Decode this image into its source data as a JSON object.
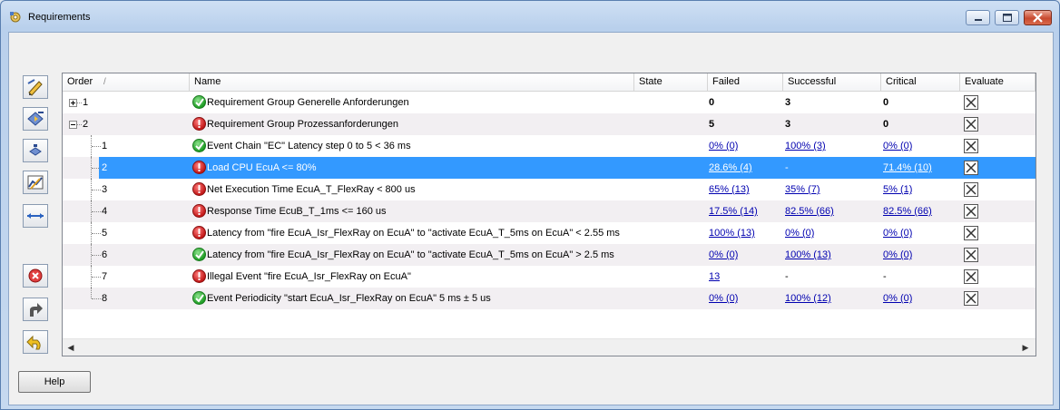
{
  "window": {
    "title": "Requirements"
  },
  "toolbar": {
    "buttons": [
      {
        "name": "edit-requirement-button",
        "icon": "pencil-icon"
      },
      {
        "name": "add-group-button",
        "icon": "add-group-icon"
      },
      {
        "name": "add-item-button",
        "icon": "add-item-icon"
      },
      {
        "name": "chart-button",
        "icon": "chart-icon"
      },
      {
        "name": "link-button",
        "icon": "arrows-icon"
      },
      {
        "name": "delete-button",
        "icon": "delete-icon"
      },
      {
        "name": "redo-button",
        "icon": "redo-icon"
      },
      {
        "name": "undo-button",
        "icon": "undo-icon"
      }
    ]
  },
  "grid": {
    "columns": {
      "order": "Order",
      "name": "Name",
      "state": "State",
      "failed": "Failed",
      "successful": "Successful",
      "critical": "Critical",
      "evaluate": "Evaluate"
    },
    "sort_indicator": "/",
    "rows": [
      {
        "order": "1",
        "name": "Requirement Group Generelle Anforderungen",
        "status": "ok",
        "failed": "0",
        "successful": "3",
        "critical": "0",
        "level": 0,
        "expander": "plus"
      },
      {
        "order": "2",
        "name": "Requirement Group Prozessanforderungen",
        "status": "error",
        "failed": "5",
        "successful": "3",
        "critical": "0",
        "level": 0,
        "expander": "minus"
      },
      {
        "order": "1",
        "name": "Event Chain \"EC\" Latency step 0 to 5 < 36 ms",
        "status": "ok",
        "failed": "0% (0)",
        "successful": "100% (3)",
        "critical": "0% (0)",
        "level": 1
      },
      {
        "order": "2",
        "name": "Load CPU EcuA <= 80%",
        "status": "error",
        "failed": "28.6% (4)",
        "successful": "-",
        "critical": "71.4% (10)",
        "level": 1,
        "selected": true
      },
      {
        "order": "3",
        "name": "Net Execution Time EcuA_T_FlexRay < 800 us",
        "status": "error",
        "failed": "65% (13)",
        "successful": "35% (7)",
        "critical": "5% (1)",
        "level": 1
      },
      {
        "order": "4",
        "name": "Response Time EcuB_T_1ms <= 160 us",
        "status": "error",
        "failed": "17.5% (14)",
        "successful": "82.5% (66)",
        "critical": "82.5% (66)",
        "level": 1
      },
      {
        "order": "5",
        "name": "Latency from \"fire EcuA_Isr_FlexRay on EcuA\" to \"activate EcuA_T_5ms on EcuA\" < 2.55 ms",
        "status": "error",
        "failed": "100% (13)",
        "successful": "0% (0)",
        "critical": "0% (0)",
        "level": 1
      },
      {
        "order": "6",
        "name": "Latency from \"fire EcuA_Isr_FlexRay on EcuA\" to \"activate EcuA_T_5ms on EcuA\" > 2.5 ms",
        "status": "ok",
        "failed": "0% (0)",
        "successful": "100% (13)",
        "critical": "0% (0)",
        "level": 1
      },
      {
        "order": "7",
        "name": "Illegal Event \"fire EcuA_Isr_FlexRay on EcuA\"",
        "status": "error",
        "failed": "13",
        "successful": "-",
        "critical": "-",
        "level": 1
      },
      {
        "order": "8",
        "name": "Event Periodicity \"start EcuA_Isr_FlexRay on EcuA\" 5 ms ± 5 us",
        "status": "ok",
        "failed": "0% (0)",
        "successful": "100% (12)",
        "critical": "0% (0)",
        "level": 1
      }
    ]
  },
  "footer": {
    "help_label": "Help"
  },
  "colors": {
    "selection": "#3399ff",
    "link": "#0000b0",
    "ok": "#1e9d24",
    "error": "#c21818"
  }
}
